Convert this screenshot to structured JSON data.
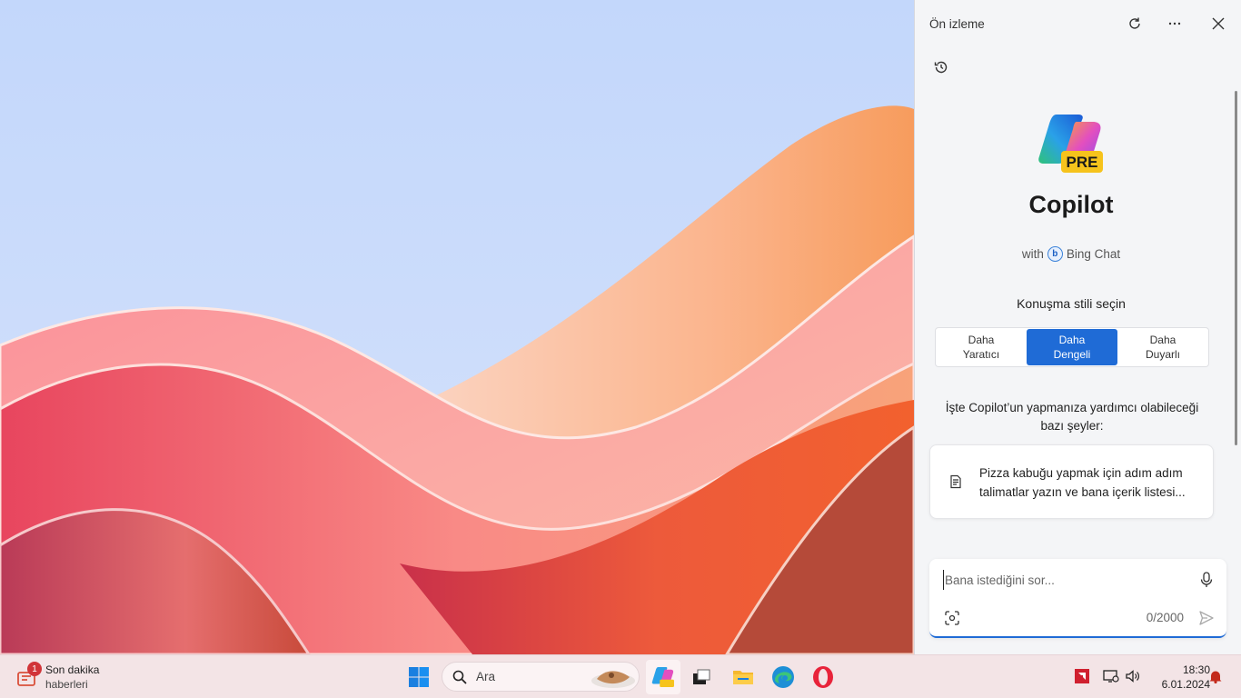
{
  "desktop": {
    "wallpaper": "windows-11-bloom-red-orange"
  },
  "copilot": {
    "pane_title": "Ön izleme",
    "header_icons": [
      "refresh-icon",
      "more-icon",
      "close-icon"
    ],
    "history_icon": "history-icon",
    "logo_badge": "PRE",
    "title": "Copilot",
    "subtitle_prefix": "with",
    "subtitle_service": "Bing Chat",
    "style_prompt": "Konuşma stili seçin",
    "styles": [
      {
        "line1": "Daha",
        "line2": "Yaratıcı",
        "active": false
      },
      {
        "line1": "Daha",
        "line2": "Dengeli",
        "active": true
      },
      {
        "line1": "Daha",
        "line2": "Duyarlı",
        "active": false
      }
    ],
    "help_text": "İşte Copilot’un yapmanıza yardımcı olabileceği bazı şeyler:",
    "suggestion": "Pizza kabuğu yapmak için adım adım talimatlar yazın ve bana içerik listesi...",
    "input_placeholder": "Bana istediğini sor...",
    "char_count": "0/2000",
    "accent_color": "#1f6bd6"
  },
  "taskbar": {
    "news_title": "Son dakika",
    "news_sub": "haberleri",
    "news_badge": "1",
    "search_placeholder": "Ara",
    "apps": [
      "start-icon",
      "copilot-icon",
      "task-view-icon",
      "file-explorer-icon",
      "edge-icon",
      "opera-icon"
    ],
    "tray": [
      "amd-icon",
      "network-icon",
      "volume-icon"
    ],
    "time": "18:30",
    "date": "6.01.2024"
  }
}
